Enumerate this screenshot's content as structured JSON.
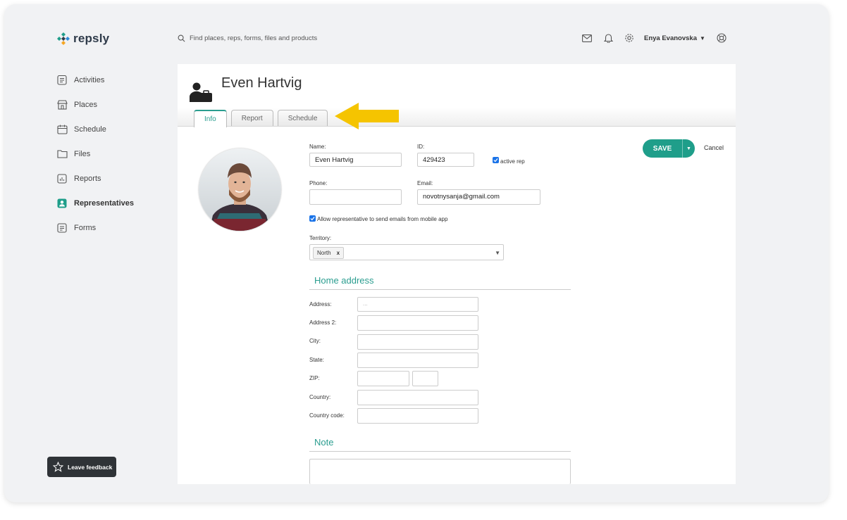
{
  "app": {
    "logo_text": "repsly"
  },
  "search": {
    "placeholder": "Find places, reps, forms, files and products"
  },
  "topbar": {
    "icons": [
      "mail-icon",
      "bell-icon",
      "gear-icon",
      "help-icon"
    ],
    "user_name": "Enya Evanovska"
  },
  "sidebar": {
    "items": [
      {
        "label": "Activities",
        "icon": "activities-icon"
      },
      {
        "label": "Places",
        "icon": "places-icon"
      },
      {
        "label": "Schedule",
        "icon": "calendar-icon"
      },
      {
        "label": "Files",
        "icon": "folder-icon"
      },
      {
        "label": "Reports",
        "icon": "reports-icon"
      },
      {
        "label": "Representatives",
        "icon": "representatives-icon",
        "active": true
      },
      {
        "label": "Forms",
        "icon": "forms-icon"
      }
    ]
  },
  "feedback": {
    "label": "Leave feedback"
  },
  "rep": {
    "name": "Even Hartvig"
  },
  "tabs": [
    {
      "label": "Info",
      "active": true
    },
    {
      "label": "Report"
    },
    {
      "label": "Schedule"
    }
  ],
  "form": {
    "name_label": "Name:",
    "name_value": "Even Hartvig",
    "id_label": "ID:",
    "id_value": "429423",
    "active_label": "active rep",
    "active_checked": true,
    "phone_label": "Phone:",
    "phone_value": "",
    "email_label": "Email:",
    "email_value": "novotnysanja@gmail.com",
    "allow_email_label": "Allow representative to send emails from mobile app",
    "allow_email_checked": true,
    "territory_label": "Territory:",
    "territory_value": "North",
    "territory_remove": "x"
  },
  "home_address": {
    "title": "Home address",
    "address_label": "Address:",
    "address_placeholder": "...",
    "address2_label": "Address 2:",
    "city_label": "City:",
    "state_label": "State:",
    "zip_label": "ZIP:",
    "country_label": "Country:",
    "country_code_label": "Country code:"
  },
  "note": {
    "title": "Note"
  },
  "actions": {
    "save_label": "SAVE",
    "cancel_label": "Cancel"
  },
  "colors": {
    "accent": "#1f9e8a",
    "arrow": "#f5c400",
    "checkbox": "#1a73e8"
  }
}
